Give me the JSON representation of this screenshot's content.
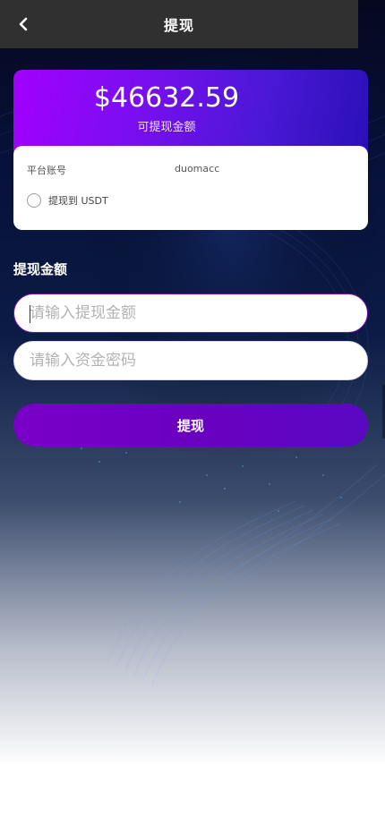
{
  "header": {
    "title": "提现",
    "back_icon": "chevron-left-icon"
  },
  "balance": {
    "amount": "$46632.59",
    "label": "可提现金额"
  },
  "account": {
    "platform_label": "平台账号",
    "platform_value": "duomacc",
    "withdraw_option_label": "提现到 USDT",
    "withdraw_option_selected": false
  },
  "form": {
    "section_title": "提现金额",
    "amount_placeholder": "请输入提现金额",
    "amount_value": "",
    "password_placeholder": "请输入资金密码",
    "password_value": "",
    "submit_label": "提现"
  },
  "colors": {
    "header_bg": "#303030",
    "card_gradient_start": "#a200ff",
    "card_gradient_end": "#2a10b8",
    "button_primary": "#6a00c0"
  }
}
